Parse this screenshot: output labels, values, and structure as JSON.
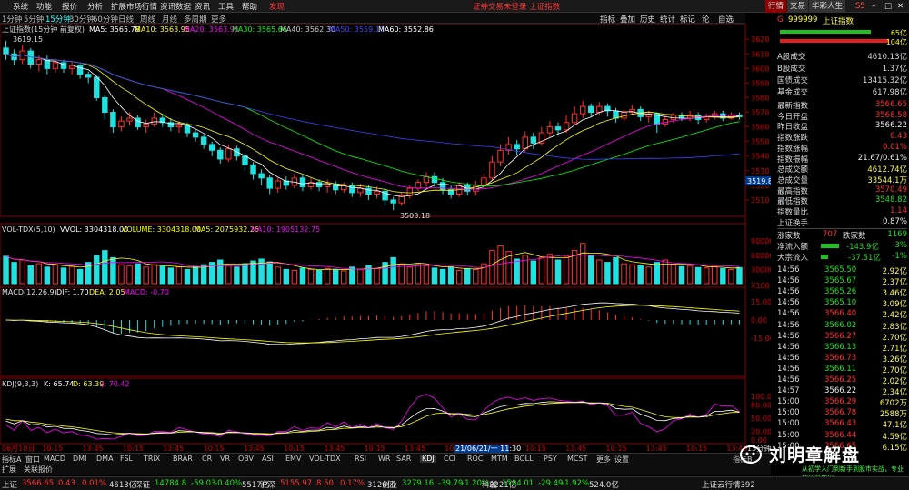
{
  "menubar": {
    "items": [
      "系统",
      "功能",
      "报价",
      "分析",
      "扩展市场行情",
      "资讯数据",
      "资讯",
      "工具",
      "帮助",
      "发现"
    ],
    "center_title": "证券交易未登录  上证指数",
    "right_buttons": [
      "行情",
      "交易",
      "华彩人生"
    ],
    "win_buttons": [
      "S5"
    ]
  },
  "period": {
    "items": [
      "1分钟",
      "5分钟",
      "15分钟",
      "30分钟",
      "60分钟",
      "日线",
      "周线",
      "月线",
      "多周期",
      "更多"
    ],
    "active": "15分钟"
  },
  "toolbar_right": [
    "指标",
    "叠加",
    "历史",
    "统计",
    "标记",
    "论",
    "自选"
  ],
  "chart_header": {
    "name": "上证指数(15分钟 前复权)",
    "ma": [
      {
        "label": "MA5: 3565.78",
        "color": "#ffffff"
      },
      {
        "label": "MA10: 3563.95",
        "color": "#ffff00"
      },
      {
        "label": "MA20: 3563.96",
        "color": "#ff00ff"
      },
      {
        "label": "MA30: 3565.66",
        "color": "#00ff00"
      },
      {
        "label": "MA40: 3562.30",
        "color": "#c0c0c0"
      },
      {
        "label": "MA50: 3559.13",
        "color": "#4040ff"
      },
      {
        "label": "MA60: 3552.86",
        "color": "#ffffff"
      }
    ]
  },
  "price_axis": [
    "3620",
    "3610",
    "3600",
    "3590",
    "3580",
    "3570",
    "3560",
    "3550",
    "3540",
    "3530",
    "3520",
    "3510"
  ],
  "price_marks": {
    "high": "3619.15",
    "low": "3503.18",
    "current": "3519.8"
  },
  "vol_header": {
    "name": "VOL-TDX(5,10)",
    "vvol": "VVOL: 3304318.00",
    "volume": "VOLUME: 3304318.00",
    "ma5": "MA5: 2075932.25",
    "ma10": "MA10: 1905132.75"
  },
  "vol_axis": [
    "90000",
    "60000",
    "30000",
    "X100"
  ],
  "macd_header": {
    "name": "MACD(12,26,9)",
    "dif": "DIF: 1.70",
    "dea": "DEA: 2.05",
    "macd": "MACD: -0.70"
  },
  "macd_axis": [
    "15.00",
    "0.00",
    "-15.00"
  ],
  "kdj_header": {
    "name": "KDJ(9,3,3)",
    "k": "K: 65.74",
    "d": "D: 63.39",
    "j": "J: 70.42"
  },
  "kdj_axis": [
    "100.00",
    "80.00",
    "50.00",
    "20.00",
    "0.00"
  ],
  "time_axis": [
    "06月10日",
    "10:15",
    "13:45",
    "10:15",
    "13:45",
    "10:15",
    "13:45",
    "10:15",
    "13:45",
    "10:15",
    "13:45",
    "10:15",
    "13:45",
    "10:15",
    "13:45",
    "10:15",
    "13:45",
    "10:15",
    "13:45"
  ],
  "time_cursor": "21/06/21/一 11:30",
  "period_tag": "15分钟",
  "tabs": [
    "指标A",
    "窗口",
    "MACD",
    "DMI",
    "DMA",
    "FSL",
    "TRIX",
    "BRAR",
    "CR",
    "VR",
    "OBV",
    "ASI",
    "EMV",
    "VOL-TDX",
    "RSI",
    "WR",
    "SAR",
    "KDJ",
    "CCI",
    "ROC",
    "MTM",
    "BOLL",
    "PSY",
    "MCST",
    "更多",
    "设置"
  ],
  "tabs_active": "KDJ",
  "tabs_right": "指标B",
  "sub2": [
    "扩展",
    "关联报价"
  ],
  "right_panel": {
    "code": "999999",
    "name": "上证指数",
    "gauges": [
      "65亿",
      "104亿"
    ],
    "a_vol": {
      "k": "A股成交",
      "v": "4610.13亿"
    },
    "b_vol": {
      "k": "B股成交",
      "v": "1.37亿"
    },
    "bond_vol": {
      "k": "国债成交",
      "v": "13415.32亿"
    },
    "fund_vol": {
      "k": "基金成交",
      "v": "617.98亿"
    },
    "stats": [
      {
        "k": "最新指数",
        "v": "3566.65",
        "c": "red"
      },
      {
        "k": "今日开盘",
        "v": "3568.58",
        "c": "red"
      },
      {
        "k": "昨日收盘",
        "v": "3566.22",
        "c": "wht"
      },
      {
        "k": "指数涨跌",
        "v": "0.43",
        "c": "red"
      },
      {
        "k": "指数涨幅",
        "v": "0.01%",
        "c": "red"
      },
      {
        "k": "指数振幅",
        "v": "21.67/0.61%",
        "c": "wht"
      },
      {
        "k": "总成交额",
        "v": "4612.74亿",
        "c": "yel"
      },
      {
        "k": "总成交量",
        "v": "33544.1万",
        "c": "yel"
      },
      {
        "k": "最高指数",
        "v": "3570.49",
        "c": "red"
      },
      {
        "k": "最低指数",
        "v": "3548.82",
        "c": "grn"
      },
      {
        "k": "指数量比",
        "v": "1.14",
        "c": "red"
      },
      {
        "k": "上证换手",
        "v": "0.87%",
        "c": "wht"
      }
    ],
    "up_label": "涨家数",
    "up": "707",
    "down_label": "跌家数",
    "down": "1169",
    "flows": [
      {
        "k": "净流入额",
        "v": "-143.9亿",
        "p": "-3%"
      },
      {
        "k": "大宗流入",
        "v": "-37.51亿",
        "p": "-1%"
      }
    ],
    "ticks": [
      {
        "t": "14:56",
        "p": "3565.50",
        "v": "2.92亿",
        "pc": "grn"
      },
      {
        "t": "14:56",
        "p": "3565.67",
        "v": "2.37亿",
        "pc": "grn"
      },
      {
        "t": "14:56",
        "p": "3565.26",
        "v": "3.46亿",
        "pc": "grn"
      },
      {
        "t": "14:56",
        "p": "3565.10",
        "v": "3.09亿",
        "pc": "grn"
      },
      {
        "t": "14:56",
        "p": "3566.40",
        "v": "2.42亿",
        "pc": "red"
      },
      {
        "t": "14:56",
        "p": "3566.02",
        "v": "2.83亿",
        "pc": "grn"
      },
      {
        "t": "14:56",
        "p": "3566.27",
        "v": "2.70亿",
        "pc": "red"
      },
      {
        "t": "14:56",
        "p": "3566.13",
        "v": "2.71亿",
        "pc": "grn"
      },
      {
        "t": "14:56",
        "p": "3566.73",
        "v": "3.26亿",
        "pc": "red"
      },
      {
        "t": "14:56",
        "p": "3566.11",
        "v": "2.70亿",
        "pc": "grn"
      },
      {
        "t": "14:56",
        "p": "3566.25",
        "v": "2.02亿",
        "pc": "red"
      },
      {
        "t": "14:57",
        "p": "3566.22",
        "v": "2.34亿",
        "pc": "wht"
      },
      {
        "t": "15:00",
        "p": "3566.29",
        "v": "6702万",
        "pc": "red"
      },
      {
        "t": "15:00",
        "p": "3566.78",
        "v": "2588万",
        "pc": "red"
      },
      {
        "t": "15:00",
        "p": "3566.43",
        "v": "47.1亿",
        "pc": "red"
      },
      {
        "t": "15:00",
        "p": "3566.44",
        "v": "4.59亿",
        "pc": "red"
      },
      {
        "t": "15:00",
        "p": "3566.65",
        "v": "6.15亿",
        "pc": "red"
      }
    ]
  },
  "watermark": {
    "text": "刘明章解盘",
    "sub": "从初学入门到新手到股市实战，专业的炒股教程"
  },
  "status": [
    {
      "name": "上证",
      "price": "3566.65",
      "chg": "0.43",
      "pct": "0.01%",
      "vol": "4613亿"
    },
    {
      "name": "深证",
      "price": "14784.8",
      "chg": "-59.03",
      "pct": "-0.40%",
      "vol": "5517亿"
    },
    {
      "name": "沪深",
      "price": "5155.97",
      "chg": "8.50",
      "pct": "0.17%",
      "vol": "3126亿"
    },
    {
      "name": "创业",
      "price": "3279.16",
      "chg": "-39.79",
      "pct": "-1.20%",
      "vol": "2221亿"
    },
    {
      "name": "科创",
      "price": "1504.01",
      "chg": "-29.49",
      "pct": "-1.92%",
      "vol": "524.0亿"
    }
  ],
  "status_right": "上证云行情392",
  "colors": {
    "up": "#ff3030",
    "down": "#20e0e0",
    "ma5": "#ffffff",
    "ma10": "#ffff00",
    "ma20": "#ff00ff",
    "ma30": "#00ff00",
    "ma60": "#4040ff"
  },
  "chart_data": {
    "type": "candlestick",
    "ylim": [
      3500,
      3622
    ],
    "candles": [
      [
        3614,
        3610,
        3619,
        3606
      ],
      [
        3610,
        3606,
        3613,
        3602
      ],
      [
        3606,
        3612,
        3616,
        3603
      ],
      [
        3612,
        3603,
        3614,
        3600
      ],
      [
        3603,
        3606,
        3609,
        3598
      ],
      [
        3606,
        3600,
        3609,
        3596
      ],
      [
        3600,
        3604,
        3607,
        3597
      ],
      [
        3604,
        3600,
        3606,
        3597
      ],
      [
        3600,
        3602,
        3604,
        3596
      ],
      [
        3602,
        3596,
        3603,
        3593
      ],
      [
        3596,
        3594,
        3598,
        3590
      ],
      [
        3594,
        3580,
        3595,
        3578
      ],
      [
        3580,
        3570,
        3582,
        3565
      ],
      [
        3570,
        3560,
        3572,
        3556
      ],
      [
        3560,
        3564,
        3567,
        3557
      ],
      [
        3564,
        3566,
        3570,
        3561
      ],
      [
        3566,
        3560,
        3568,
        3558
      ],
      [
        3560,
        3562,
        3565,
        3556
      ],
      [
        3562,
        3566,
        3570,
        3560
      ],
      [
        3566,
        3563,
        3569,
        3560
      ],
      [
        3563,
        3560,
        3566,
        3557
      ],
      [
        3560,
        3561,
        3564,
        3556
      ],
      [
        3561,
        3556,
        3563,
        3553
      ],
      [
        3556,
        3553,
        3558,
        3550
      ],
      [
        3553,
        3548,
        3555,
        3545
      ],
      [
        3548,
        3544,
        3550,
        3540
      ],
      [
        3544,
        3538,
        3546,
        3535
      ],
      [
        3538,
        3545,
        3548,
        3536
      ],
      [
        3545,
        3540,
        3547,
        3537
      ],
      [
        3540,
        3534,
        3542,
        3530
      ],
      [
        3534,
        3528,
        3536,
        3524
      ],
      [
        3528,
        3525,
        3531,
        3520
      ],
      [
        3525,
        3518,
        3527,
        3514
      ],
      [
        3518,
        3523,
        3525,
        3515
      ],
      [
        3523,
        3520,
        3526,
        3517
      ],
      [
        3520,
        3525,
        3528,
        3518
      ],
      [
        3525,
        3519,
        3527,
        3516
      ],
      [
        3519,
        3522,
        3525,
        3517
      ],
      [
        3522,
        3519,
        3524,
        3516
      ],
      [
        3519,
        3521,
        3524,
        3515
      ],
      [
        3521,
        3517,
        3523,
        3514
      ],
      [
        3517,
        3520,
        3522,
        3515
      ],
      [
        3520,
        3515,
        3522,
        3512
      ],
      [
        3515,
        3518,
        3521,
        3512
      ],
      [
        3518,
        3514,
        3520,
        3510
      ],
      [
        3514,
        3516,
        3519,
        3511
      ],
      [
        3516,
        3510,
        3518,
        3506
      ],
      [
        3510,
        3508,
        3512,
        3503
      ],
      [
        3508,
        3513,
        3515,
        3506
      ],
      [
        3513,
        3518,
        3520,
        3511
      ],
      [
        3518,
        3522,
        3524,
        3516
      ],
      [
        3522,
        3526,
        3529,
        3519
      ],
      [
        3526,
        3522,
        3529,
        3519
      ],
      [
        3522,
        3517,
        3525,
        3514
      ],
      [
        3517,
        3514,
        3520,
        3511
      ],
      [
        3514,
        3520,
        3522,
        3512
      ],
      [
        3520,
        3516,
        3522,
        3513
      ],
      [
        3516,
        3520,
        3523,
        3513
      ],
      [
        3520,
        3525,
        3528,
        3518
      ],
      [
        3525,
        3536,
        3540,
        3523
      ],
      [
        3536,
        3544,
        3548,
        3533
      ],
      [
        3544,
        3548,
        3553,
        3541
      ],
      [
        3548,
        3545,
        3551,
        3541
      ],
      [
        3545,
        3553,
        3557,
        3543
      ],
      [
        3553,
        3549,
        3556,
        3545
      ],
      [
        3549,
        3556,
        3560,
        3547
      ],
      [
        3556,
        3560,
        3564,
        3553
      ],
      [
        3560,
        3558,
        3563,
        3554
      ],
      [
        3558,
        3563,
        3568,
        3556
      ],
      [
        3563,
        3569,
        3574,
        3561
      ],
      [
        3569,
        3574,
        3578,
        3566
      ],
      [
        3574,
        3570,
        3576,
        3567
      ],
      [
        3570,
        3574,
        3577,
        3568
      ],
      [
        3574,
        3571,
        3576,
        3567
      ],
      [
        3571,
        3566,
        3573,
        3563
      ],
      [
        3566,
        3570,
        3572,
        3564
      ],
      [
        3570,
        3572,
        3575,
        3568
      ],
      [
        3572,
        3567,
        3574,
        3564
      ],
      [
        3567,
        3569,
        3571,
        3563
      ],
      [
        3569,
        3562,
        3570,
        3556
      ],
      [
        3562,
        3565,
        3568,
        3560
      ],
      [
        3565,
        3568,
        3570,
        3563
      ],
      [
        3568,
        3566,
        3570,
        3564
      ],
      [
        3566,
        3568,
        3571,
        3564
      ],
      [
        3568,
        3565,
        3570,
        3562
      ],
      [
        3565,
        3567,
        3569,
        3563
      ],
      [
        3567,
        3569,
        3571,
        3565
      ],
      [
        3569,
        3566,
        3571,
        3564
      ],
      [
        3566,
        3568,
        3570,
        3565
      ],
      [
        3568,
        3567,
        3570,
        3565
      ]
    ],
    "volume": [
      58,
      45,
      50,
      38,
      42,
      35,
      40,
      33,
      36,
      30,
      45,
      60,
      70,
      55,
      40,
      38,
      42,
      35,
      40,
      37,
      33,
      35,
      30,
      36,
      40,
      45,
      50,
      38,
      35,
      42,
      48,
      52,
      46,
      35,
      30,
      28,
      33,
      30,
      28,
      32,
      30,
      27,
      35,
      30,
      38,
      32,
      45,
      55,
      40,
      35,
      42,
      38,
      33,
      30,
      35,
      28,
      32,
      30,
      42,
      70,
      80,
      68,
      52,
      60,
      48,
      55,
      62,
      50,
      58,
      70,
      85,
      60,
      50,
      45,
      55,
      42,
      40,
      38,
      35,
      45,
      50,
      40,
      36,
      38,
      34,
      33,
      36,
      32,
      30,
      34
    ],
    "vol_unit": "X100"
  }
}
